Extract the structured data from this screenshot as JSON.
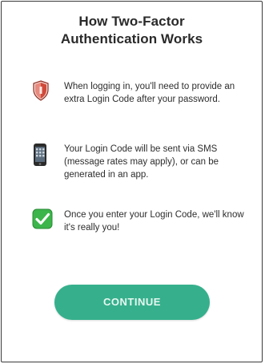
{
  "modal": {
    "title_line1": "How Two-Factor",
    "title_line2": "Authentication Works"
  },
  "steps": [
    {
      "icon": "shield-icon",
      "text": "When logging in, you'll need to provide an extra Login Code after your password."
    },
    {
      "icon": "phone-icon",
      "text": "Your Login Code will be sent via SMS (message rates may apply), or can be generated in an app."
    },
    {
      "icon": "checkmark-icon",
      "text": "Once you enter your Login Code, we'll know it's really you!"
    }
  ],
  "actions": {
    "continue_label": "CONTINUE"
  },
  "colors": {
    "accent": "#36b08c",
    "shield": "#c0392b",
    "check": "#3cb54a"
  }
}
